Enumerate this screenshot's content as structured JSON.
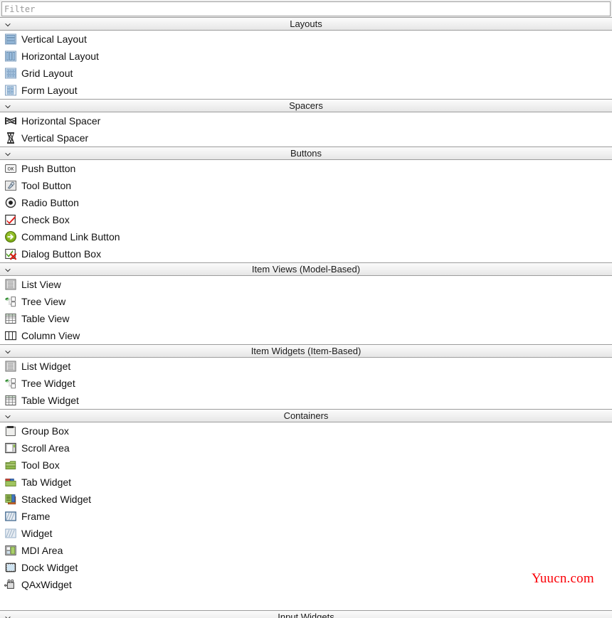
{
  "filter": {
    "placeholder": "Filter",
    "value": ""
  },
  "watermark": {
    "text": "Yuucn.com",
    "color": "#fb0007"
  },
  "icons": {
    "chevron": "chevron-down-icon"
  },
  "sections": [
    {
      "title": "Layouts",
      "items": [
        {
          "label": "Vertical Layout",
          "icon": "vertical-layout-icon"
        },
        {
          "label": "Horizontal Layout",
          "icon": "horizontal-layout-icon"
        },
        {
          "label": "Grid Layout",
          "icon": "grid-layout-icon"
        },
        {
          "label": "Form Layout",
          "icon": "form-layout-icon"
        }
      ]
    },
    {
      "title": "Spacers",
      "items": [
        {
          "label": "Horizontal Spacer",
          "icon": "horizontal-spacer-icon"
        },
        {
          "label": "Vertical Spacer",
          "icon": "vertical-spacer-icon"
        }
      ]
    },
    {
      "title": "Buttons",
      "items": [
        {
          "label": "Push Button",
          "icon": "push-button-icon"
        },
        {
          "label": "Tool Button",
          "icon": "tool-button-icon"
        },
        {
          "label": "Radio Button",
          "icon": "radio-button-icon"
        },
        {
          "label": "Check Box",
          "icon": "check-box-icon"
        },
        {
          "label": "Command Link Button",
          "icon": "command-link-button-icon"
        },
        {
          "label": "Dialog Button Box",
          "icon": "dialog-button-box-icon"
        }
      ]
    },
    {
      "title": "Item Views (Model-Based)",
      "items": [
        {
          "label": "List View",
          "icon": "list-view-icon"
        },
        {
          "label": "Tree View",
          "icon": "tree-view-icon"
        },
        {
          "label": "Table View",
          "icon": "table-view-icon"
        },
        {
          "label": "Column View",
          "icon": "column-view-icon"
        }
      ]
    },
    {
      "title": "Item Widgets (Item-Based)",
      "items": [
        {
          "label": "List Widget",
          "icon": "list-widget-icon"
        },
        {
          "label": "Tree Widget",
          "icon": "tree-widget-icon"
        },
        {
          "label": "Table Widget",
          "icon": "table-widget-icon"
        }
      ]
    },
    {
      "title": "Containers",
      "items": [
        {
          "label": "Group Box",
          "icon": "group-box-icon"
        },
        {
          "label": "Scroll Area",
          "icon": "scroll-area-icon"
        },
        {
          "label": "Tool Box",
          "icon": "tool-box-icon"
        },
        {
          "label": "Tab Widget",
          "icon": "tab-widget-icon"
        },
        {
          "label": "Stacked Widget",
          "icon": "stacked-widget-icon"
        },
        {
          "label": "Frame",
          "icon": "frame-icon"
        },
        {
          "label": "Widget",
          "icon": "widget-icon"
        },
        {
          "label": "MDI Area",
          "icon": "mdi-area-icon"
        },
        {
          "label": "Dock Widget",
          "icon": "dock-widget-icon"
        },
        {
          "label": "QAxWidget",
          "icon": "qax-widget-icon"
        }
      ]
    }
  ],
  "clipped_section": {
    "title": "Input Widgets"
  }
}
